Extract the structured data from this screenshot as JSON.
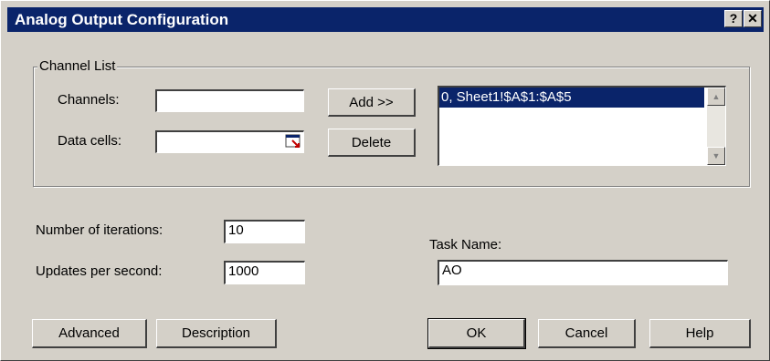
{
  "window": {
    "title": "Analog Output Configuration",
    "help_label": "?",
    "close_label": "✕"
  },
  "channel_list": {
    "group_label": "Channel List",
    "channels_label": "Channels:",
    "channels_value": "",
    "data_cells_label": "Data cells:",
    "data_cells_value": "",
    "add_label": "Add >>",
    "delete_label": "Delete",
    "items": [
      "0, Sheet1!$A$1:$A$5"
    ]
  },
  "settings": {
    "iterations_label": "Number of iterations:",
    "iterations_value": "10",
    "updates_label": "Updates per second:",
    "updates_value": "1000",
    "task_name_label": "Task Name:",
    "task_name_value": "AO"
  },
  "buttons": {
    "advanced": "Advanced",
    "description": "Description",
    "ok": "OK",
    "cancel": "Cancel",
    "help": "Help"
  },
  "icons": {
    "scroll_up": "up-arrow-icon",
    "scroll_down": "down-arrow-icon",
    "cell_picker": "cell-picker-icon"
  },
  "colors": {
    "titlebar": "#0a246a",
    "face": "#d4d0c8",
    "selection": "#0a246a"
  }
}
